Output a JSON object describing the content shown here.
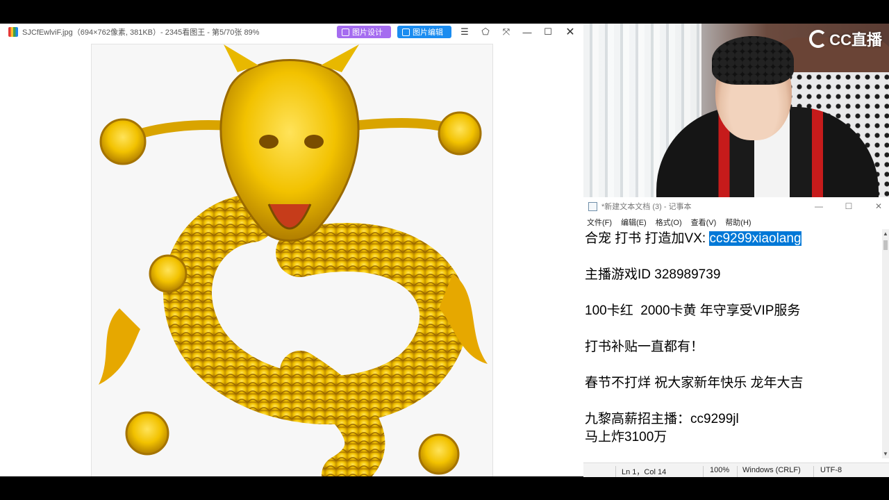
{
  "viewer": {
    "title": "SJCfEwlviF.jpg（694×762像素, 381KB）- 2345看图王 - 第5/70张 89%",
    "design_button": "图片设计",
    "edit_button": "图片编辑",
    "icons": [
      "menu-icon",
      "shirt-icon",
      "fullscreen-icon",
      "minimize-icon",
      "maximize-icon",
      "close-icon"
    ]
  },
  "webcam": {
    "logo_text": "CC直播"
  },
  "notepad": {
    "title": "*新建文本文档 (3) - 记事本",
    "menu": [
      "文件(F)",
      "编辑(E)",
      "格式(O)",
      "查看(V)",
      "帮助(H)"
    ],
    "lines": [
      {
        "text": "合宠 打书 打造加VX: ",
        "selected": "cc9299xiaolang"
      },
      {
        "text": "主播游戏ID 328989739"
      },
      {
        "text": "100卡红  2000卡黄 年守享受VIP服务"
      },
      {
        "text": "打书补贴一直都有！"
      },
      {
        "text": "春节不打烊 祝大家新年快乐 龙年大吉"
      },
      {
        "text": "九黎高薪招主播：cc9299jl"
      },
      {
        "text": "马上炸3100万"
      }
    ],
    "status": {
      "position": "Ln 1，Col 14",
      "zoom": "100%",
      "line_ending": "Windows (CRLF)",
      "encoding": "UTF-8"
    }
  }
}
